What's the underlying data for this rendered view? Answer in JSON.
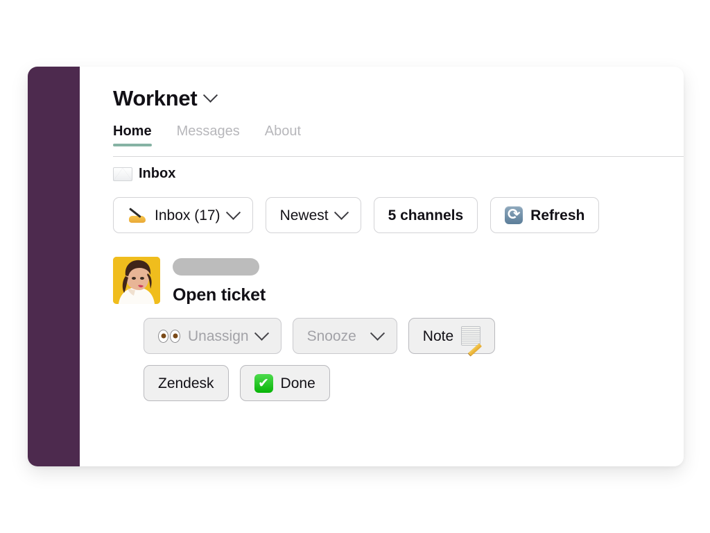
{
  "workspace": {
    "name": "Worknet",
    "dropdown_icon": "chevron-down-icon"
  },
  "tabs": [
    {
      "label": "Home",
      "active": true
    },
    {
      "label": "Messages",
      "active": false
    },
    {
      "label": "About",
      "active": false
    }
  ],
  "inbox": {
    "heading": "Inbox",
    "heading_icon": "envelope-icon",
    "toolbar": [
      {
        "label": "Inbox (17)",
        "icon": "writing-hand-icon",
        "has_chevron": true,
        "style": "white"
      },
      {
        "label": "Newest",
        "icon": null,
        "has_chevron": true,
        "style": "white"
      },
      {
        "label": "5 channels",
        "icon": null,
        "has_chevron": false,
        "style": "white-bold"
      },
      {
        "label": "Refresh",
        "icon": "refresh-icon",
        "has_chevron": false,
        "style": "white-bold"
      }
    ]
  },
  "message": {
    "avatar_alt": "user-avatar",
    "sender_redacted": "",
    "title": "Open ticket",
    "actions_row_1": [
      {
        "label": "Unassign",
        "icon": "eyes-icon",
        "has_chevron": true,
        "disabled": true
      },
      {
        "label": "Snooze",
        "icon": null,
        "has_chevron": true,
        "disabled": true
      },
      {
        "label": "Note",
        "icon": "memo-icon",
        "icon_position": "after",
        "has_chevron": false,
        "disabled": false
      }
    ],
    "actions_row_2": [
      {
        "label": "Zendesk",
        "icon": null,
        "has_chevron": false,
        "disabled": false
      },
      {
        "label": "Done",
        "icon": "check-mark-icon",
        "has_chevron": false,
        "disabled": false
      }
    ]
  },
  "colors": {
    "sidebar": "#4d2a4e",
    "active_tab_underline": "#86b3a4",
    "avatar_background": "#f0bd1d",
    "redaction_bar": "#bcbcbc",
    "card_background": "#ffffff",
    "page_background": "#ffffff"
  }
}
